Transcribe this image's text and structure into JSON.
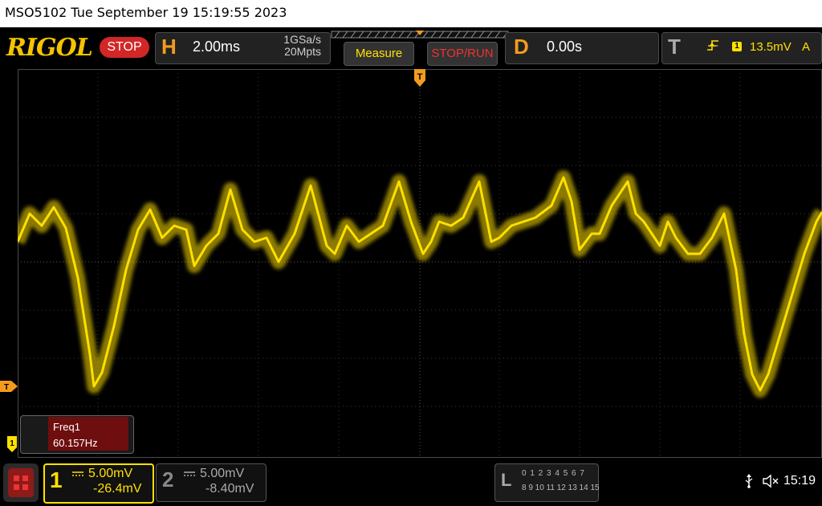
{
  "title_bar": {
    "text": "MSO5102  Tue September 19 15:19:55 2023"
  },
  "toolbar": {
    "logo": "RIGOL",
    "run_state": "STOP",
    "horizontal": {
      "letter": "H",
      "timebase": "2.00ms",
      "sample_rate": "1GSa/s",
      "memory_depth": "20Mpts"
    },
    "measure_label": "Measure",
    "stop_run_label": "STOP/RUN",
    "delay": {
      "letter": "D",
      "value": "0.00s"
    },
    "trigger": {
      "letter": "T",
      "source": "1",
      "level": "13.5mV",
      "mode": "A"
    }
  },
  "markers": {
    "trigger_position": "T",
    "trigger_level": "T",
    "channel1": "1"
  },
  "measurement": {
    "name": "Freq1",
    "value": "60.157Hz"
  },
  "channels": [
    {
      "number": "1",
      "scale": "5.00mV",
      "offset": "-26.4mV",
      "color": "#ffe000",
      "active": true
    },
    {
      "number": "2",
      "scale": "5.00mV",
      "offset": "-8.40mV",
      "color": "#9a9a9a",
      "active": false
    }
  ],
  "logic_analyzer": {
    "letter": "L",
    "row1": "0 1 2 3  4 5 6 7",
    "row2": "8 9 10 11 12 13 14 15"
  },
  "status": {
    "clock": "15:19"
  },
  "colors": {
    "trace": "#ffe000",
    "grid": "#3a3a3a",
    "accent": "#f39b1e",
    "stop": "#d32626"
  },
  "icons": [
    "menu-icon",
    "usb-icon",
    "speaker-muted-icon",
    "trigger-rising-edge-icon"
  ]
}
